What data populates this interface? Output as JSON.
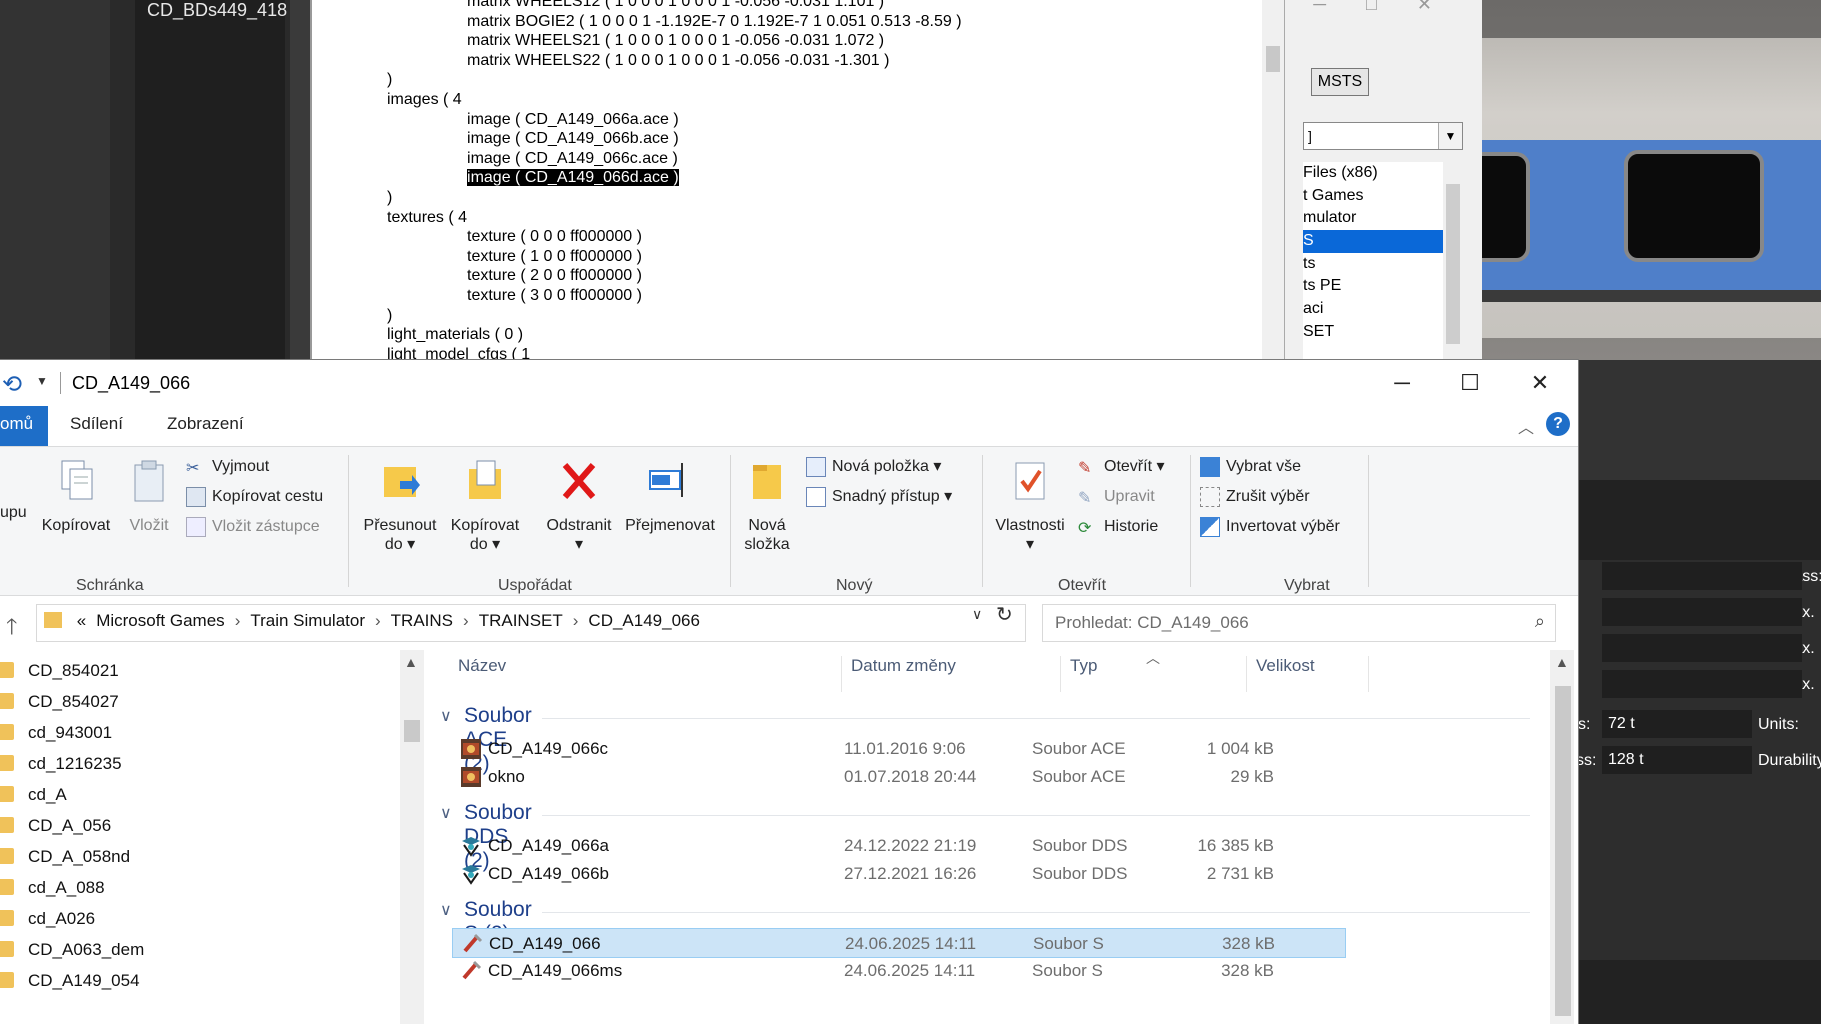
{
  "bg_left": {
    "item": "CD_BDs449_418"
  },
  "text_editor": {
    "lines": [
      "                  matrix WHEELS12 ( 1 0 0 0 1 0 0 0 1 -0.056 -0.031 1.101 )",
      "                  matrix BOGIE2 ( 1 0 0 0 1 -1.192E-7 0 1.192E-7 1 0.051 0.513 -8.59 )",
      "                  matrix WHEELS21 ( 1 0 0 0 1 0 0 0 1 -0.056 -0.031 1.072 )",
      "                  matrix WHEELS22 ( 1 0 0 0 1 0 0 0 1 -0.056 -0.031 -1.301 )",
      ")",
      "images ( 4",
      "                  image ( CD_A149_066a.ace )",
      "                  image ( CD_A149_066b.ace )",
      "                  image ( CD_A149_066c.ace )",
      "__SELECTED__",
      ")",
      "textures ( 4",
      "                  texture ( 0 0 0 ff000000 )",
      "                  texture ( 1 0 0 ff000000 )",
      "                  texture ( 2 0 0 ff000000 )",
      "                  texture ( 3 0 0 ff000000 )",
      ")",
      "light_materials ( 0 )",
      "light_model_cfgs ( 1"
    ],
    "selected_prefix": "                  ",
    "selected_text": "image ( CD_A149_066d.ace )"
  },
  "msts_dialog": {
    "button": "MSTS",
    "combo_value": "]",
    "tree": [
      "Files (x86)",
      "t Games",
      "mulator",
      "S",
      "ts",
      "ts PE",
      "aci",
      "SET"
    ],
    "selected_index": 3
  },
  "train_panel": {
    "labels_right": [
      "Mass:",
      "Max.",
      "Max.",
      "Max."
    ],
    "mass_row": {
      "left": "s:",
      "value": "72 t",
      "right": "Units:"
    },
    "mass2_row": {
      "left": "ss:",
      "value": "128 t",
      "right": "Durability"
    }
  },
  "explorer": {
    "title": "CD_A149_066",
    "tabs": {
      "home": "omů",
      "share": "Sdílení",
      "view": "Zobrazení"
    },
    "ribbon": {
      "clipboard": {
        "label": "Schránka",
        "pin": "upu",
        "copy": "Kopírovat",
        "paste": "Vložit",
        "cut": "Vyjmout",
        "copy_path": "Kopírovat cestu",
        "paste_shortcut": "Vložit zástupce"
      },
      "organize": {
        "label": "Uspořádat",
        "move_to": "Přesunout",
        "move_to2": "do",
        "copy_to": "Kopírovat",
        "copy_to2": "do",
        "delete": "Odstranit",
        "rename": "Přejmenovat"
      },
      "new": {
        "label": "Nový",
        "new_folder": "Nová",
        "new_folder2": "složka",
        "new_item": "Nová položka",
        "easy_access": "Snadný přístup"
      },
      "open": {
        "label": "Otevřít",
        "properties": "Vlastnosti",
        "open": "Otevřít",
        "edit": "Upravit",
        "history": "Historie"
      },
      "select": {
        "label": "Vybrat",
        "select_all": "Vybrat vše",
        "select_none": "Zrušit výběr",
        "invert": "Invertovat výběr"
      }
    },
    "address": {
      "crumbs": [
        "«",
        "Microsoft Games",
        "Train Simulator",
        "TRAINS",
        "TRAINSET",
        "CD_A149_066"
      ],
      "search_placeholder": "Prohledat: CD_A149_066"
    },
    "nav_items": [
      "CD_854021",
      "CD_854027",
      "cd_943001",
      "cd_1216235",
      "cd_A",
      "CD_A_056",
      "CD_A_058nd",
      "cd_A_088",
      "cd_A026",
      "CD_A063_dem",
      "CD_A149_054"
    ],
    "columns": {
      "name": "Název",
      "date": "Datum změny",
      "type": "Typ",
      "size": "Velikost"
    },
    "groups": [
      {
        "name": "Soubor ACE (2)",
        "icon": "ace-file-icon",
        "files": [
          {
            "name": "CD_A149_066c",
            "date": "11.01.2016 9:06",
            "type": "Soubor ACE",
            "size": "1 004 kB"
          },
          {
            "name": "okno",
            "date": "01.07.2018 20:44",
            "type": "Soubor ACE",
            "size": "29 kB"
          }
        ]
      },
      {
        "name": "Soubor DDS (2)",
        "icon": "dds-file-icon",
        "files": [
          {
            "name": "CD_A149_066a",
            "date": "24.12.2022 21:19",
            "type": "Soubor DDS",
            "size": "16 385 kB"
          },
          {
            "name": "CD_A149_066b",
            "date": "27.12.2021 16:26",
            "type": "Soubor DDS",
            "size": "2 731 kB"
          }
        ]
      },
      {
        "name": "Soubor S (2)",
        "icon": "s-file-icon",
        "files": [
          {
            "name": "CD_A149_066",
            "date": "24.06.2025 14:11",
            "type": "Soubor S",
            "size": "328 kB",
            "selected": true
          },
          {
            "name": "CD_A149_066ms",
            "date": "24.06.2025 14:11",
            "type": "Soubor S",
            "size": "328 kB"
          }
        ]
      }
    ]
  }
}
